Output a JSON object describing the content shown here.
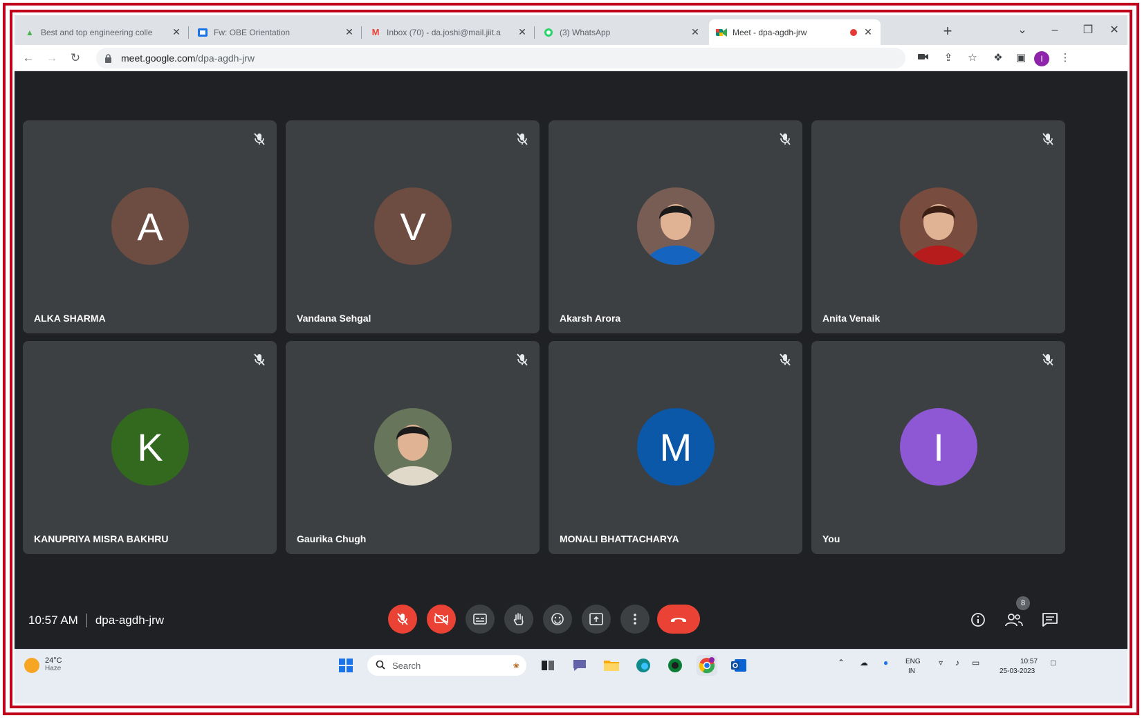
{
  "browser": {
    "tabs": [
      {
        "title": "Best and top engineering colle",
        "favicon": "tree-icon",
        "color": "#4caf50"
      },
      {
        "title": "Fw: OBE Orientation",
        "favicon": "outlook-icon",
        "color": "#1a73e8"
      },
      {
        "title": "Inbox (70) - da.joshi@mail.jiit.a",
        "favicon": "gmail-icon",
        "color": "#ea4335"
      },
      {
        "title": "(3) WhatsApp",
        "favicon": "whatsapp-icon",
        "color": "#25d366"
      },
      {
        "title": "Meet - dpa-agdh-jrw",
        "favicon": "meet-icon",
        "color": "#00897b",
        "active": true
      }
    ],
    "url_host": "meet.google.com",
    "url_path": "/dpa-agdh-jrw",
    "profile_initial": "I"
  },
  "meeting": {
    "time": "10:57 AM",
    "code": "dpa-agdh-jrw",
    "participants_count": "8",
    "participants": [
      {
        "name": "ALKA SHARMA",
        "initial": "A",
        "color": "#6d4c41",
        "photo": false
      },
      {
        "name": "Vandana Sehgal",
        "initial": "V",
        "color": "#6d4c41",
        "photo": false
      },
      {
        "name": "Akarsh Arora",
        "initial": "",
        "color": "#8d6e63",
        "photo": true
      },
      {
        "name": "Anita Venaik",
        "initial": "",
        "color": "#8d5a4a",
        "photo": true
      },
      {
        "name": "KANUPRIYA MISRA BAKHRU",
        "initial": "K",
        "color": "#33691e",
        "photo": false
      },
      {
        "name": "Gaurika Chugh",
        "initial": "",
        "color": "#7a8a6a",
        "photo": true
      },
      {
        "name": "MONALI BHATTACHARYA",
        "initial": "M",
        "color": "#0b57a8",
        "photo": false
      },
      {
        "name": "You",
        "initial": "I",
        "color": "#8e57d4",
        "photo": false
      }
    ]
  },
  "taskbar": {
    "temperature": "24°C",
    "weather_condition": "Haze",
    "search_placeholder": "Search",
    "language": "ENG",
    "language_region": "IN",
    "clock_time": "10:57",
    "clock_date": "25-03-2023"
  },
  "colors": {
    "meet_bg": "#202124",
    "tile_bg": "#3c4043",
    "danger": "#ea4335",
    "frame": "#c0001a"
  }
}
